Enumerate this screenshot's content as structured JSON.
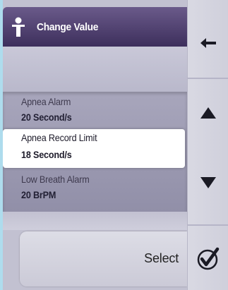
{
  "header": {
    "title": "Change Value",
    "icon": "person-icon"
  },
  "list": [
    {
      "label": "Apnea Alarm",
      "value": "20 Second/s",
      "selected": false
    },
    {
      "label": "Apnea Record Limit",
      "value": "18 Second/s",
      "selected": true
    },
    {
      "label": "Low Breath Alarm",
      "value": "20 BrPM",
      "selected": false
    }
  ],
  "actions": {
    "select_label": "Select"
  },
  "sidebar": {
    "back_icon": "arrow-left-icon",
    "up_icon": "triangle-up-icon",
    "down_icon": "triangle-down-icon",
    "confirm_icon": "checkmark-circle-icon"
  },
  "colors": {
    "header": "#4a3b6b",
    "list_background": "#9f9db4",
    "page_background": "#aedced"
  }
}
